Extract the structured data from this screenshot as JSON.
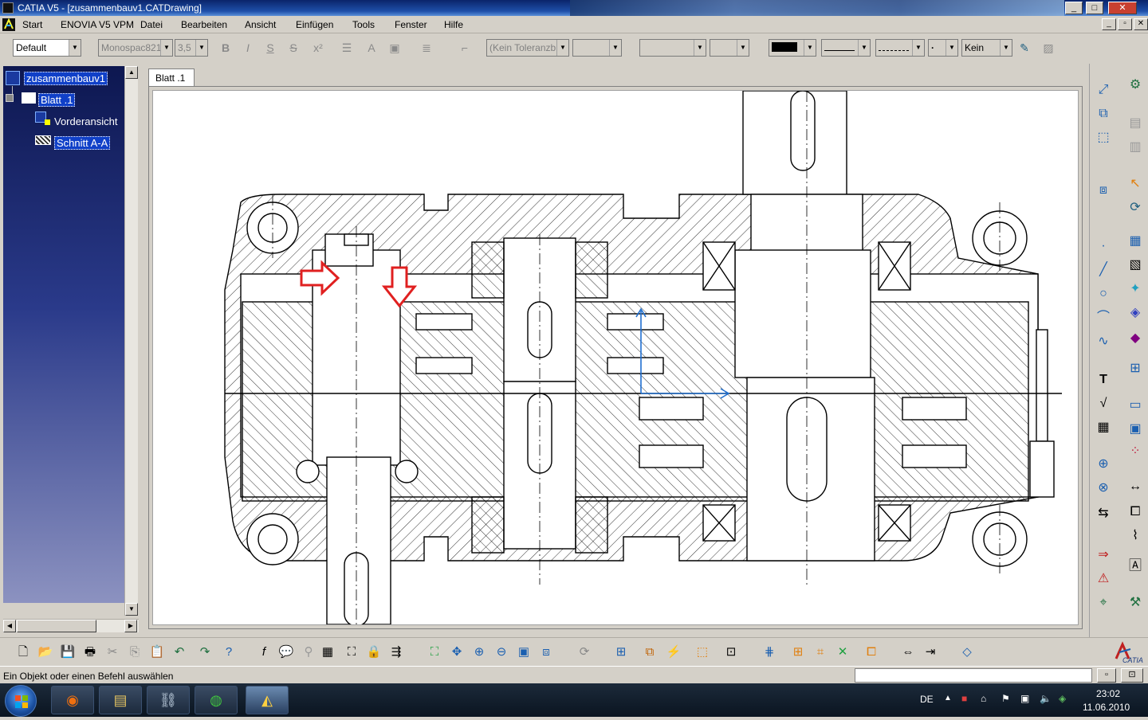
{
  "window": {
    "title": "CATIA V5 - [zusammenbauv1.CATDrawing]",
    "buttons": [
      "_",
      "□",
      "✕"
    ]
  },
  "menu": {
    "items": [
      "Start",
      "ENOVIA V5 VPM",
      "Datei",
      "Bearbeiten",
      "Ansicht",
      "Einfügen",
      "Tools",
      "Fenster",
      "Hilfe"
    ],
    "doc_buttons": [
      "_",
      "▫",
      "✕"
    ]
  },
  "toolbar": {
    "style_combo": "Default",
    "font_combo": "Monospac821",
    "size_combo": "3,5",
    "tolerance_combo": "(Kein Toleranzb",
    "pattern_combo": "Kein"
  },
  "tree": {
    "root": "zusammenbauv1",
    "sheet": "Blatt .1",
    "views": [
      "Vorderansicht",
      "Schnitt A-A"
    ]
  },
  "tabs": {
    "active": "Blatt .1"
  },
  "status": {
    "message": "Ein Objekt oder einen Befehl auswählen"
  },
  "taskbar": {
    "language": "DE",
    "time": "23:02",
    "date": "11.06.2010"
  },
  "colors": {
    "accent": "#0a246a",
    "annotation_arrow": "#e02020",
    "axis_system": "#2070d0",
    "tree_selection": "#1040c8"
  }
}
